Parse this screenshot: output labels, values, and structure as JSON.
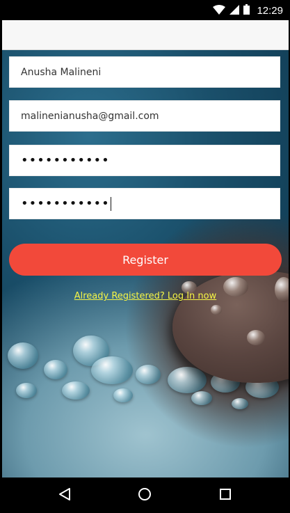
{
  "status_bar": {
    "time": "12:29",
    "icons": [
      "wifi-icon",
      "signal-icon",
      "battery-icon"
    ]
  },
  "app_bar": {
    "title": ""
  },
  "form": {
    "name": "Anusha Malineni",
    "email": "malinenianusha@gmail.com",
    "password": "•••••••••••",
    "confirm_password": "•••••••••••"
  },
  "register_label": "Register",
  "login_link": "Already Registered? Log In now",
  "nav_bar": {
    "buttons": [
      "back-icon",
      "home-icon",
      "recents-icon"
    ]
  },
  "colors": {
    "accent": "#f2493a",
    "link": "#f5f545",
    "status_bar": "#000000"
  }
}
